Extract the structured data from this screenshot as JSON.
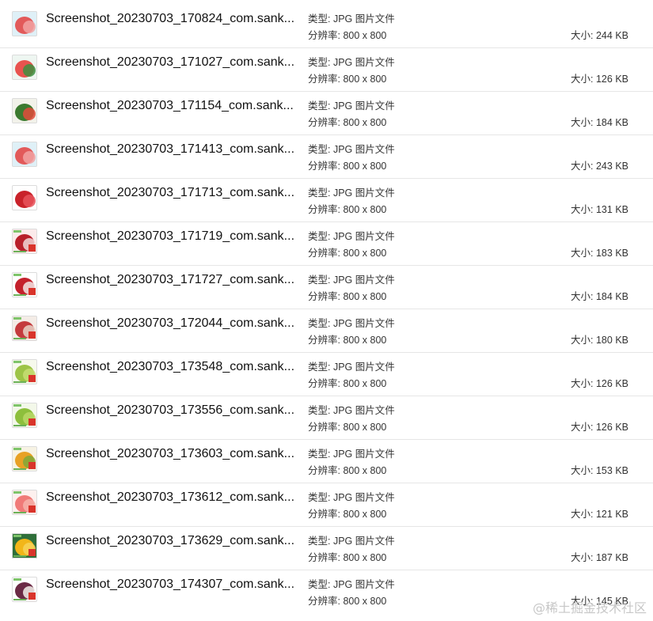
{
  "labels": {
    "type_prefix": "类型:",
    "resolution_prefix": "分辨率:",
    "size_prefix": "大小:"
  },
  "files": [
    {
      "name": "Screenshot_20230703_170824_com.sank...",
      "type": "JPG 图片文件",
      "resolution": "800 x 800",
      "size": "244 KB",
      "thumb": "watermelon-icon",
      "fruit_color": "#e25a5a",
      "fruit_color2": "#f2a3a3",
      "bg": "#dff0f7",
      "tags": false
    },
    {
      "name": "Screenshot_20230703_171027_com.sank...",
      "type": "JPG 图片文件",
      "resolution": "800 x 800",
      "size": "126 KB",
      "thumb": "watermelon-icon",
      "fruit_color": "#e8534f",
      "fruit_color2": "#3d8f3f",
      "bg": "#eef6f1",
      "tags": false
    },
    {
      "name": "Screenshot_20230703_171154_com.sank...",
      "type": "JPG 图片文件",
      "resolution": "800 x 800",
      "size": "184 KB",
      "thumb": "watermelon-icon",
      "fruit_color": "#3b7a2f",
      "fruit_color2": "#e24b3b",
      "bg": "#f2f2ea",
      "tags": false
    },
    {
      "name": "Screenshot_20230703_171413_com.sank...",
      "type": "JPG 图片文件",
      "resolution": "800 x 800",
      "size": "243 KB",
      "thumb": "watermelon-icon",
      "fruit_color": "#e25a5a",
      "fruit_color2": "#f2a3a3",
      "bg": "#dff0f7",
      "tags": false
    },
    {
      "name": "Screenshot_20230703_171713_com.sank...",
      "type": "JPG 图片文件",
      "resolution": "800 x 800",
      "size": "131 KB",
      "thumb": "lychee-icon",
      "fruit_color": "#c9222a",
      "fruit_color2": "#e7525a",
      "bg": "#ffffff",
      "tags": false
    },
    {
      "name": "Screenshot_20230703_171719_com.sank...",
      "type": "JPG 图片文件",
      "resolution": "800 x 800",
      "size": "183 KB",
      "thumb": "lychee-icon",
      "fruit_color": "#b81f2a",
      "fruit_color2": "#f0d7d7",
      "bg": "#fbeaea",
      "tags": true
    },
    {
      "name": "Screenshot_20230703_171727_com.sank...",
      "type": "JPG 图片文件",
      "resolution": "800 x 800",
      "size": "184 KB",
      "thumb": "lychee-icon",
      "fruit_color": "#c4212c",
      "fruit_color2": "#f3e6e6",
      "bg": "#ffffff",
      "tags": true
    },
    {
      "name": "Screenshot_20230703_172044_com.sank...",
      "type": "JPG 图片文件",
      "resolution": "800 x 800",
      "size": "180 KB",
      "thumb": "apple-icon",
      "fruit_color": "#c43a3d",
      "fruit_color2": "#e8d3c7",
      "bg": "#f4ece6",
      "tags": true
    },
    {
      "name": "Screenshot_20230703_173548_com.sank...",
      "type": "JPG 图片文件",
      "resolution": "800 x 800",
      "size": "126 KB",
      "thumb": "pear-icon",
      "fruit_color": "#9dc447",
      "fruit_color2": "#c7de74",
      "bg": "#f6f9ec",
      "tags": true
    },
    {
      "name": "Screenshot_20230703_173556_com.sank...",
      "type": "JPG 图片文件",
      "resolution": "800 x 800",
      "size": "126 KB",
      "thumb": "pear-icon",
      "fruit_color": "#8dbf3c",
      "fruit_color2": "#b9d866",
      "bg": "#f3f8e9",
      "tags": true
    },
    {
      "name": "Screenshot_20230703_173603_com.sank...",
      "type": "JPG 图片文件",
      "resolution": "800 x 800",
      "size": "153 KB",
      "thumb": "orange-icon",
      "fruit_color": "#e8a125",
      "fruit_color2": "#7fa83a",
      "bg": "#f7f3e4",
      "tags": true
    },
    {
      "name": "Screenshot_20230703_173612_com.sank...",
      "type": "JPG 图片文件",
      "resolution": "800 x 800",
      "size": "121 KB",
      "thumb": "peach-icon",
      "fruit_color": "#f07a78",
      "fruit_color2": "#f6b3aa",
      "bg": "#fdf0ee",
      "tags": true
    },
    {
      "name": "Screenshot_20230703_173629_com.sank...",
      "type": "JPG 图片文件",
      "resolution": "800 x 800",
      "size": "187 KB",
      "thumb": "orange-icon",
      "fruit_color": "#f2b619",
      "fruit_color2": "#f7d35a",
      "bg": "#2f6f3a",
      "tags": true
    },
    {
      "name": "Screenshot_20230703_174307_com.sank...",
      "type": "JPG 图片文件",
      "resolution": "800 x 800",
      "size": "145 KB",
      "thumb": "mangosteen-icon",
      "fruit_color": "#6b2a45",
      "fruit_color2": "#f3f0ea",
      "bg": "#ffffff",
      "tags": true
    }
  ],
  "watermark": "@稀土掘金技术社区"
}
